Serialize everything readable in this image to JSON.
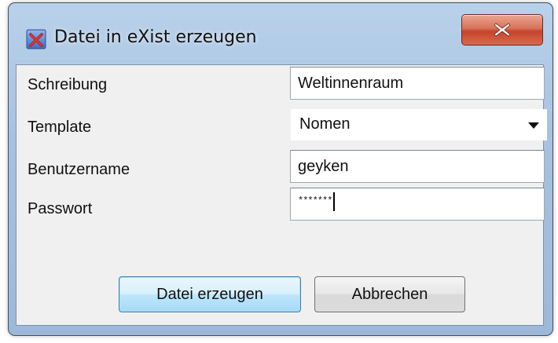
{
  "window": {
    "title": "Datei in eXist erzeugen",
    "app_icon": "x-app-icon",
    "close_icon": "close-icon"
  },
  "form": {
    "schreibung": {
      "label": "Schreibung",
      "value": "Weltinnenraum"
    },
    "template": {
      "label": "Template",
      "selected": "Nomen"
    },
    "benutzername": {
      "label": "Benutzername",
      "value": "geyken"
    },
    "passwort": {
      "label": "Passwort",
      "masked_value": "*******"
    }
  },
  "buttons": {
    "create_label": "Datei erzeugen",
    "cancel_label": "Abbrechen"
  },
  "colors": {
    "titlebar": "#a7c2e0",
    "close_button": "#c4442b",
    "client_bg": "#f0f0f0",
    "default_button": "#bee6fd"
  }
}
